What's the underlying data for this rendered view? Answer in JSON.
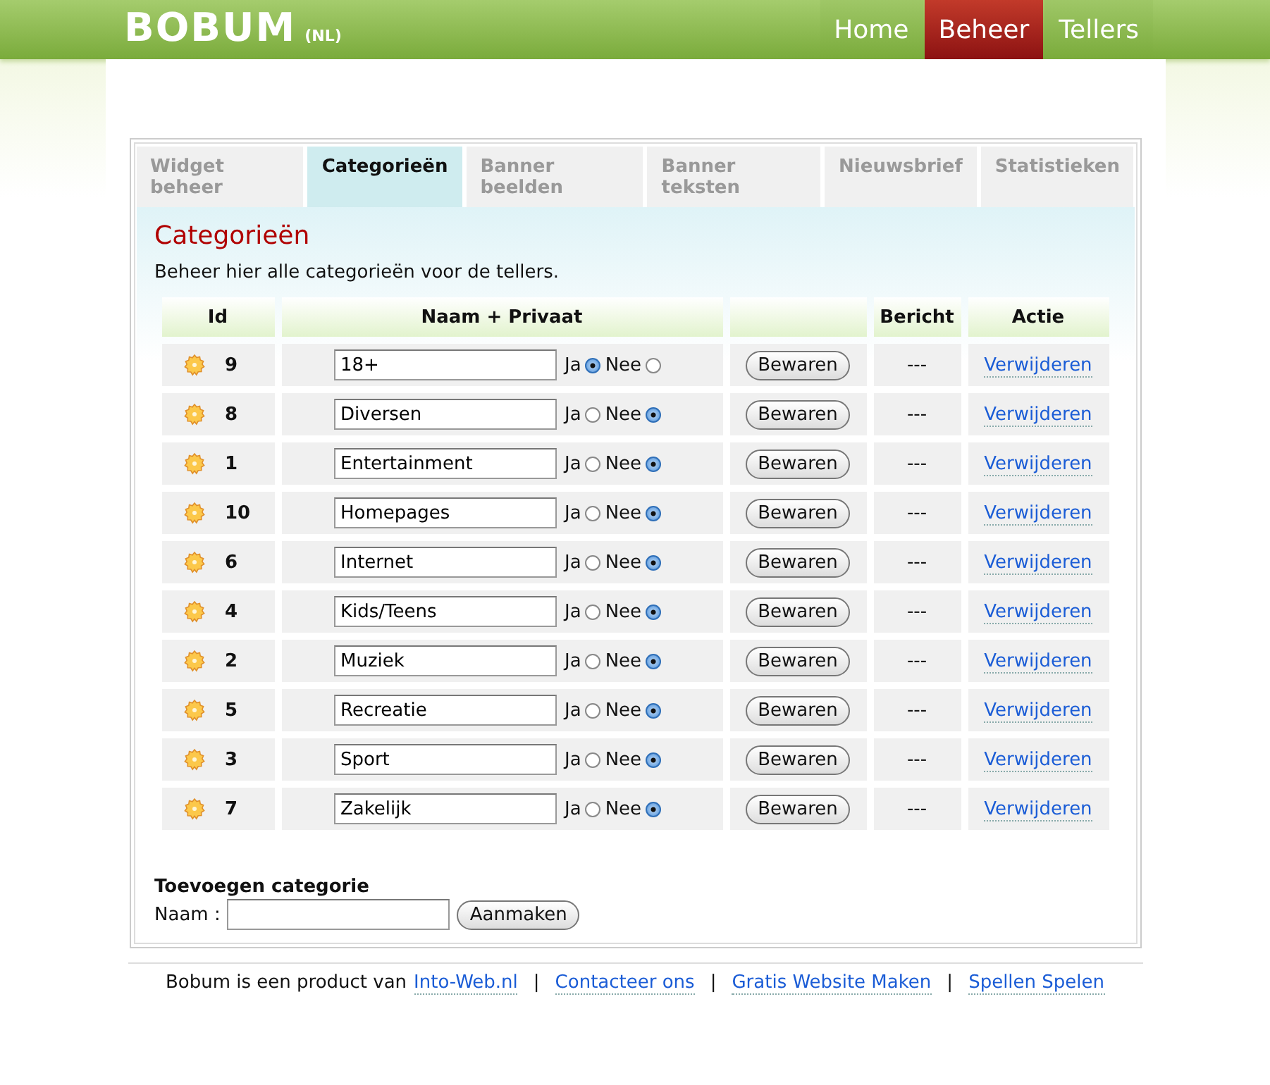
{
  "logo": {
    "name": "BOBUM",
    "suffix": "(NL)"
  },
  "nav": [
    {
      "label": "Home",
      "selected": false
    },
    {
      "label": "Beheer",
      "selected": true
    },
    {
      "label": "Tellers",
      "selected": false
    }
  ],
  "tabs": [
    {
      "label": "Widget beheer",
      "selected": false
    },
    {
      "label": "Categorieën",
      "selected": true
    },
    {
      "label": "Banner beelden",
      "selected": false
    },
    {
      "label": "Banner teksten",
      "selected": false
    },
    {
      "label": "Nieuwsbrief",
      "selected": false
    },
    {
      "label": "Statistieken",
      "selected": false
    }
  ],
  "heading": "Categorieën",
  "intro": "Beheer hier alle categorieën voor de tellers.",
  "table": {
    "columns": [
      "Id",
      "Naam + Privaat",
      "Bericht",
      "Actie"
    ],
    "rows": [
      {
        "id": "9",
        "name": "18+",
        "options": [
          {
            "label": "Ja",
            "selected": true
          },
          {
            "label": "Nee",
            "selected": false
          }
        ],
        "button": "Bewaren",
        "message": "---",
        "action": "Verwijderen"
      },
      {
        "id": "8",
        "name": "Diversen",
        "options": [
          {
            "label": "Ja",
            "selected": false
          },
          {
            "label": "Nee",
            "selected": true
          }
        ],
        "button": "Bewaren",
        "message": "---",
        "action": "Verwijderen"
      },
      {
        "id": "1",
        "name": "Entertainment",
        "options": [
          {
            "label": "Ja",
            "selected": false
          },
          {
            "label": "Nee",
            "selected": true
          }
        ],
        "button": "Bewaren",
        "message": "---",
        "action": "Verwijderen"
      },
      {
        "id": "10",
        "name": "Homepages",
        "options": [
          {
            "label": "Ja",
            "selected": false
          },
          {
            "label": "Nee",
            "selected": true
          }
        ],
        "button": "Bewaren",
        "message": "---",
        "action": "Verwijderen"
      },
      {
        "id": "6",
        "name": "Internet",
        "options": [
          {
            "label": "Ja",
            "selected": false
          },
          {
            "label": "Nee",
            "selected": true
          }
        ],
        "button": "Bewaren",
        "message": "---",
        "action": "Verwijderen"
      },
      {
        "id": "4",
        "name": "Kids/Teens",
        "options": [
          {
            "label": "Ja",
            "selected": false
          },
          {
            "label": "Nee",
            "selected": true
          }
        ],
        "button": "Bewaren",
        "message": "---",
        "action": "Verwijderen"
      },
      {
        "id": "2",
        "name": "Muziek",
        "options": [
          {
            "label": "Ja",
            "selected": false
          },
          {
            "label": "Nee",
            "selected": true
          }
        ],
        "button": "Bewaren",
        "message": "---",
        "action": "Verwijderen"
      },
      {
        "id": "5",
        "name": "Recreatie",
        "options": [
          {
            "label": "Ja",
            "selected": false
          },
          {
            "label": "Nee",
            "selected": true
          }
        ],
        "button": "Bewaren",
        "message": "---",
        "action": "Verwijderen"
      },
      {
        "id": "3",
        "name": "Sport",
        "options": [
          {
            "label": "Ja",
            "selected": false
          },
          {
            "label": "Nee",
            "selected": true
          }
        ],
        "button": "Bewaren",
        "message": "---",
        "action": "Verwijderen"
      },
      {
        "id": "7",
        "name": "Zakelijk",
        "options": [
          {
            "label": "Ja",
            "selected": false
          },
          {
            "label": "Nee",
            "selected": true
          }
        ],
        "button": "Bewaren",
        "message": "---",
        "action": "Verwijderen"
      }
    ]
  },
  "add": {
    "title": "Toevoegen categorie",
    "label": "Naam :",
    "button": "Aanmaken"
  },
  "footer": {
    "text": "Bobum is een product van",
    "links": [
      "Into-Web.nl",
      "Contacteer ons",
      "Gratis Website Maken",
      "Spellen Spelen"
    ],
    "separator": "|"
  }
}
